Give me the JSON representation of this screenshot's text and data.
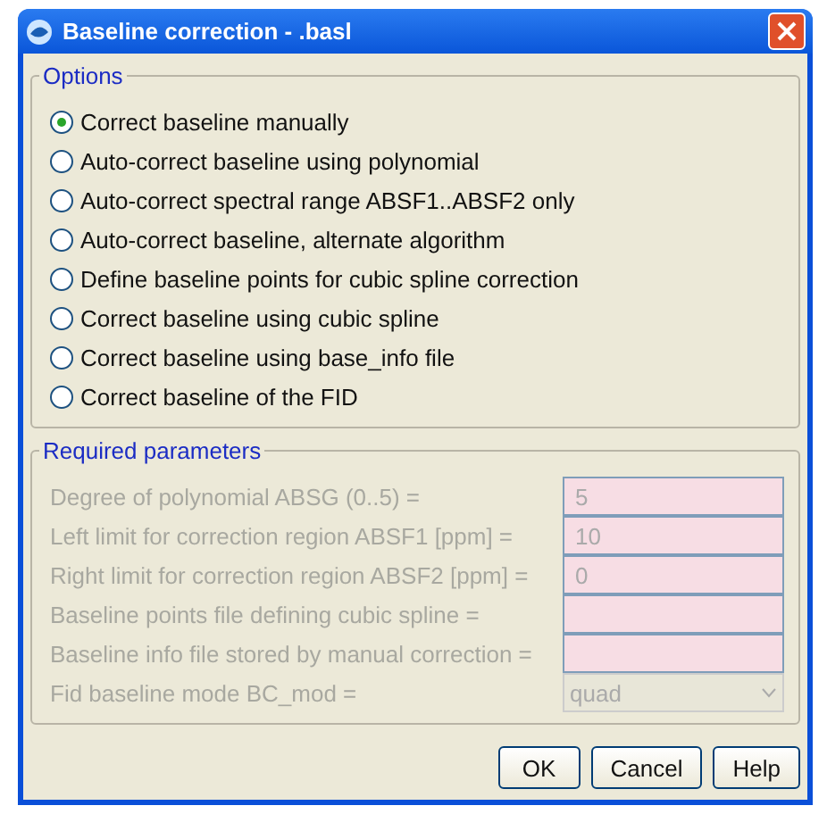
{
  "window": {
    "title": "Baseline correction - .basl"
  },
  "options": {
    "title": "Options",
    "items": [
      {
        "label": "Correct baseline manually",
        "selected": true
      },
      {
        "label": "Auto-correct baseline using polynomial",
        "selected": false
      },
      {
        "label": "Auto-correct spectral range ABSF1..ABSF2 only",
        "selected": false
      },
      {
        "label": "Auto-correct baseline, alternate algorithm",
        "selected": false
      },
      {
        "label": "Define baseline points for cubic spline correction",
        "selected": false
      },
      {
        "label": "Correct baseline using cubic spline",
        "selected": false
      },
      {
        "label": "Correct baseline using base_info file",
        "selected": false
      },
      {
        "label": "Correct baseline of the FID",
        "selected": false
      }
    ]
  },
  "parameters": {
    "title": "Required parameters",
    "fields": [
      {
        "kind": "text",
        "label": "Degree of polynomial ABSG (0..5) =",
        "value": "5",
        "disabled": true
      },
      {
        "kind": "text",
        "label": "Left limit for correction region ABSF1 [ppm] =",
        "value": "10",
        "disabled": true
      },
      {
        "kind": "text",
        "label": "Right limit for correction region ABSF2 [ppm] =",
        "value": "0",
        "disabled": true
      },
      {
        "kind": "text",
        "label": "Baseline points file defining cubic spline =",
        "disabled": true
      },
      {
        "kind": "text",
        "label": "Baseline info file stored by manual correction =",
        "disabled": true
      },
      {
        "kind": "select",
        "label": "Fid baseline mode BC_mod =",
        "value": "quad",
        "disabled": true
      }
    ]
  },
  "buttons": [
    "OK",
    "Cancel",
    "Help"
  ]
}
